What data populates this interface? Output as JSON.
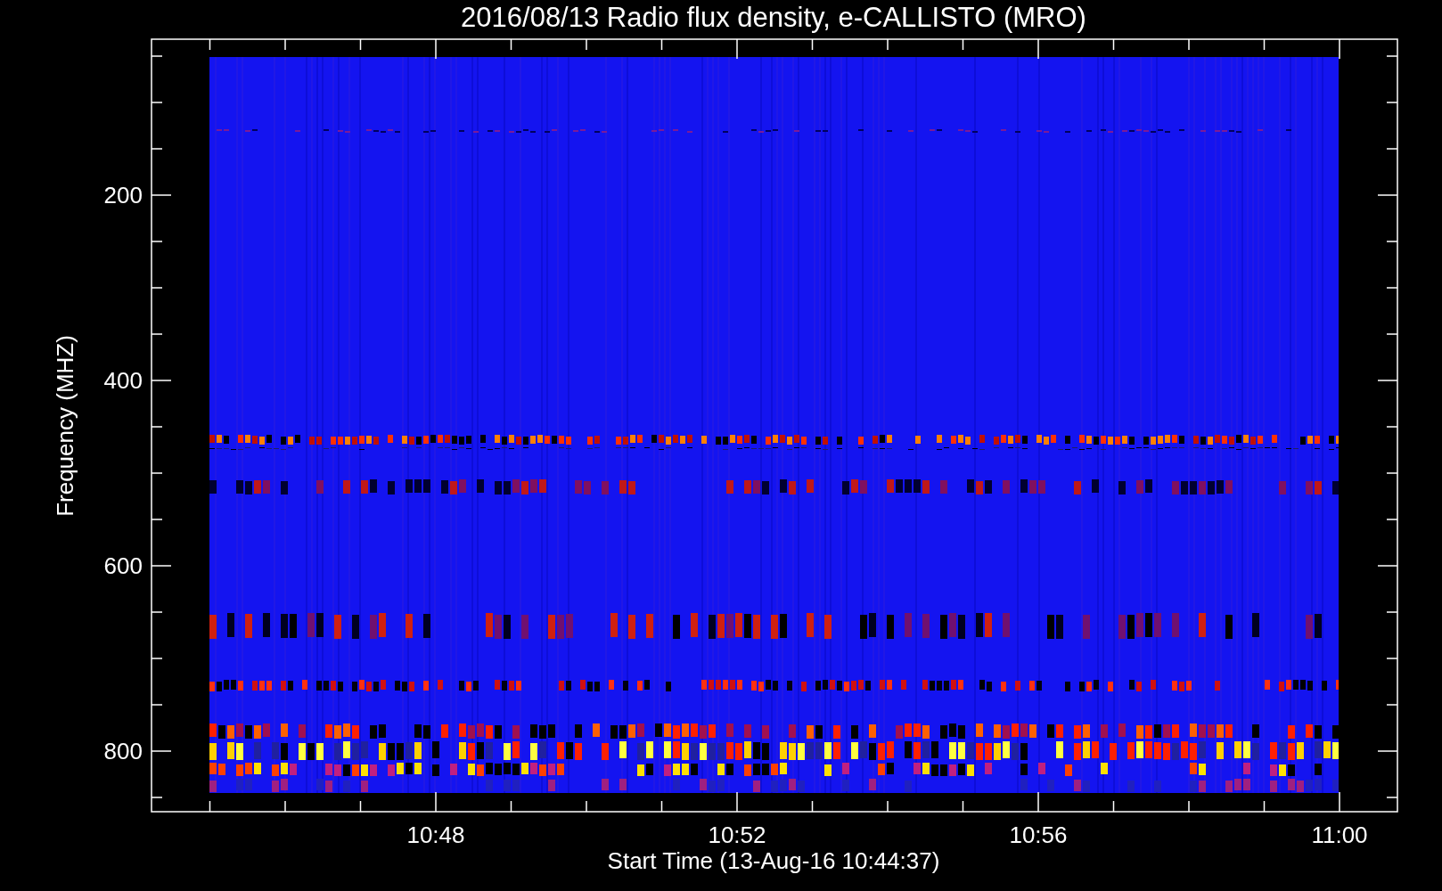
{
  "title": "2016/08/13  Radio flux density, e-CALLISTO (MRO)",
  "y_axis": {
    "label": "Frequency (MHZ)",
    "ticks": [
      "200",
      "400",
      "600",
      "800"
    ]
  },
  "x_axis": {
    "label": "Start Time (13-Aug-16 10:44:37)",
    "ticks": [
      "10:48",
      "10:52",
      "10:56",
      "11:00"
    ]
  }
}
